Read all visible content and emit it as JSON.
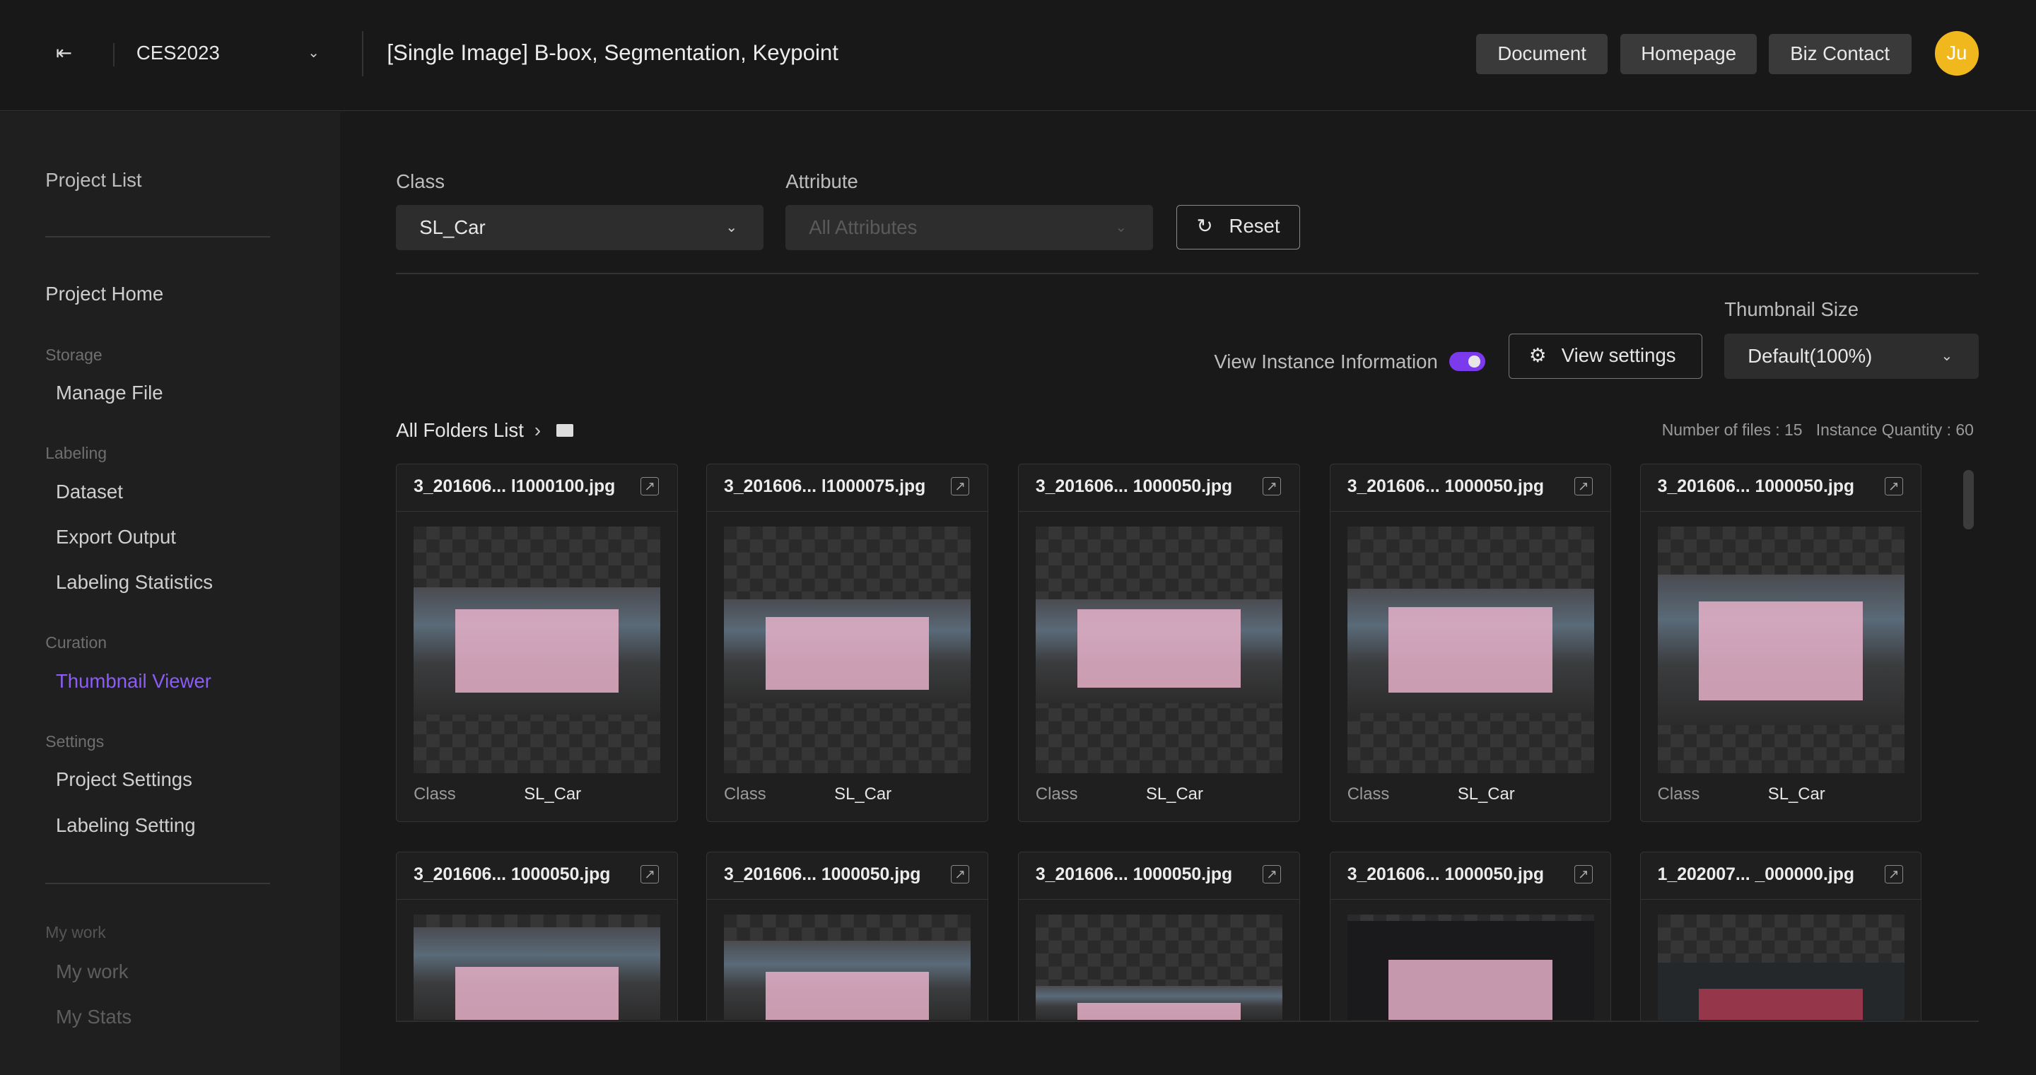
{
  "header": {
    "project": "CES2023",
    "title": "[Single Image] B-box, Segmentation, Keypoint",
    "buttons": [
      "Document",
      "Homepage",
      "Biz Contact"
    ],
    "avatar": "Ju",
    "avatar_color": "#f0b81c"
  },
  "sidebar": {
    "project_list": "Project List",
    "project_home": "Project Home",
    "sections": [
      {
        "title": "Storage",
        "items": [
          "Manage File"
        ]
      },
      {
        "title": "Labeling",
        "items": [
          "Dataset",
          "Export Output",
          "Labeling Statistics"
        ]
      },
      {
        "title": "Curation",
        "items": [
          "Thumbnail Viewer"
        ]
      },
      {
        "title": "Settings",
        "items": [
          "Project Settings",
          "Labeling Setting"
        ]
      },
      {
        "title": "My work",
        "items": [
          "My work",
          "My Stats"
        ]
      }
    ],
    "active": "Thumbnail Viewer",
    "accent": "#8b5cf6"
  },
  "filters": {
    "class_label": "Class",
    "class_value": "SL_Car",
    "attribute_label": "Attribute",
    "attribute_placeholder": "All Attributes",
    "reset": "Reset"
  },
  "view": {
    "instance_info_label": "View Instance Information",
    "instance_info_on": true,
    "view_settings": "View settings",
    "thumb_size_label": "Thumbnail Size",
    "thumb_size_value": "Default(100%)"
  },
  "breadcrumb": {
    "folder": "All Folders List"
  },
  "stats": {
    "files": "Number of files : 15",
    "instances": "Instance Quantity : 60"
  },
  "cards": [
    {
      "name": "3_201606... l1000100.jpg",
      "class_label": "Class",
      "class": "SL_Car"
    },
    {
      "name": "3_201606... l1000075.jpg",
      "class_label": "Class",
      "class": "SL_Car"
    },
    {
      "name": "3_201606... 1000050.jpg",
      "class_label": "Class",
      "class": "SL_Car"
    },
    {
      "name": "3_201606... 1000050.jpg",
      "class_label": "Class",
      "class": "SL_Car"
    },
    {
      "name": "3_201606... 1000050.jpg",
      "class_label": "Class",
      "class": "SL_Car"
    },
    {
      "name": "3_201606... 1000050.jpg"
    },
    {
      "name": "3_201606... 1000050.jpg"
    },
    {
      "name": "3_201606... 1000050.jpg"
    },
    {
      "name": "3_201606... 1000050.jpg"
    },
    {
      "name": "1_202007... _000000.jpg"
    }
  ]
}
